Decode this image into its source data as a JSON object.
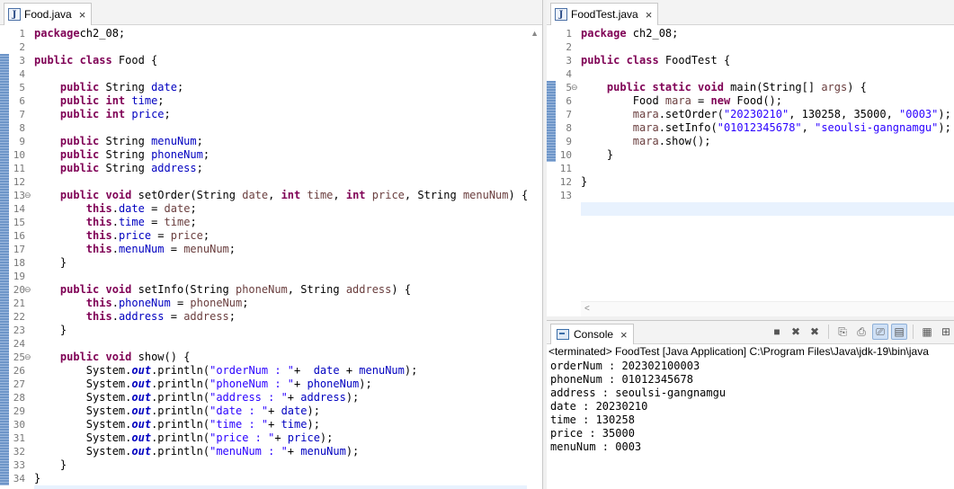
{
  "left_editor": {
    "tab_icon": "java-file-icon",
    "tab_label": "Food.java",
    "close_glyph": "×",
    "fold_glyph": "⊖",
    "current_line": 35,
    "changed_lines": [
      3,
      4,
      5,
      6,
      7,
      8,
      9,
      10,
      11,
      12,
      13,
      14,
      15,
      16,
      17,
      18,
      19,
      20,
      21,
      22,
      23,
      24,
      25,
      26,
      27,
      28,
      29,
      30,
      31,
      32,
      33,
      34
    ],
    "lines": [
      {
        "n": "1",
        "tokens": [
          [
            "kw",
            "package"
          ],
          [
            "",
            "ch2_08;"
          ]
        ]
      },
      {
        "n": "2",
        "tokens": []
      },
      {
        "n": "3",
        "tokens": [
          [
            "kw",
            "public class"
          ],
          [
            "",
            " Food {"
          ]
        ]
      },
      {
        "n": "4",
        "tokens": []
      },
      {
        "n": "5",
        "tokens": [
          [
            "",
            "    "
          ],
          [
            "kw",
            "public"
          ],
          [
            "",
            " String "
          ],
          [
            "fld",
            "date"
          ],
          [
            "",
            ";"
          ]
        ]
      },
      {
        "n": "6",
        "tokens": [
          [
            "",
            "    "
          ],
          [
            "kw",
            "public int"
          ],
          [
            "",
            " "
          ],
          [
            "fld",
            "time"
          ],
          [
            "",
            ";"
          ]
        ]
      },
      {
        "n": "7",
        "tokens": [
          [
            "",
            "    "
          ],
          [
            "kw",
            "public int"
          ],
          [
            "",
            " "
          ],
          [
            "fld",
            "price"
          ],
          [
            "",
            ";"
          ]
        ]
      },
      {
        "n": "8",
        "tokens": []
      },
      {
        "n": "9",
        "tokens": [
          [
            "",
            "    "
          ],
          [
            "kw",
            "public"
          ],
          [
            "",
            " String "
          ],
          [
            "fld",
            "menuNum"
          ],
          [
            "",
            ";"
          ]
        ]
      },
      {
        "n": "10",
        "tokens": [
          [
            "",
            "    "
          ],
          [
            "kw",
            "public"
          ],
          [
            "",
            " String "
          ],
          [
            "fld",
            "phoneNum"
          ],
          [
            "",
            ";"
          ]
        ]
      },
      {
        "n": "11",
        "tokens": [
          [
            "",
            "    "
          ],
          [
            "kw",
            "public"
          ],
          [
            "",
            " String "
          ],
          [
            "fld",
            "address"
          ],
          [
            "",
            ";"
          ]
        ]
      },
      {
        "n": "12",
        "tokens": []
      },
      {
        "n": "13",
        "fold": true,
        "tokens": [
          [
            "",
            "    "
          ],
          [
            "kw",
            "public void"
          ],
          [
            "",
            " setOrder(String "
          ],
          [
            "par",
            "date"
          ],
          [
            "",
            ", "
          ],
          [
            "kw",
            "int"
          ],
          [
            "",
            " "
          ],
          [
            "par",
            "time"
          ],
          [
            "",
            ", "
          ],
          [
            "kw",
            "int"
          ],
          [
            "",
            " "
          ],
          [
            "par",
            "price"
          ],
          [
            "",
            ", String "
          ],
          [
            "par",
            "menuNum"
          ],
          [
            "",
            ") {"
          ]
        ]
      },
      {
        "n": "14",
        "tokens": [
          [
            "",
            "        "
          ],
          [
            "kw",
            "this"
          ],
          [
            "",
            "."
          ],
          [
            "fld",
            "date"
          ],
          [
            "",
            " = "
          ],
          [
            "par",
            "date"
          ],
          [
            "",
            ";"
          ]
        ]
      },
      {
        "n": "15",
        "tokens": [
          [
            "",
            "        "
          ],
          [
            "kw",
            "this"
          ],
          [
            "",
            "."
          ],
          [
            "fld",
            "time"
          ],
          [
            "",
            " = "
          ],
          [
            "par",
            "time"
          ],
          [
            "",
            ";"
          ]
        ]
      },
      {
        "n": "16",
        "tokens": [
          [
            "",
            "        "
          ],
          [
            "kw",
            "this"
          ],
          [
            "",
            "."
          ],
          [
            "fld",
            "price"
          ],
          [
            "",
            " = "
          ],
          [
            "par",
            "price"
          ],
          [
            "",
            ";"
          ]
        ]
      },
      {
        "n": "17",
        "tokens": [
          [
            "",
            "        "
          ],
          [
            "kw",
            "this"
          ],
          [
            "",
            "."
          ],
          [
            "fld",
            "menuNum"
          ],
          [
            "",
            " = "
          ],
          [
            "par",
            "menuNum"
          ],
          [
            "",
            ";"
          ]
        ]
      },
      {
        "n": "18",
        "tokens": [
          [
            "",
            "    }"
          ]
        ]
      },
      {
        "n": "19",
        "tokens": []
      },
      {
        "n": "20",
        "fold": true,
        "tokens": [
          [
            "",
            "    "
          ],
          [
            "kw",
            "public void"
          ],
          [
            "",
            " setInfo(String "
          ],
          [
            "par",
            "phoneNum"
          ],
          [
            "",
            ", String "
          ],
          [
            "par",
            "address"
          ],
          [
            "",
            ") {"
          ]
        ]
      },
      {
        "n": "21",
        "tokens": [
          [
            "",
            "        "
          ],
          [
            "kw",
            "this"
          ],
          [
            "",
            "."
          ],
          [
            "fld",
            "phoneNum"
          ],
          [
            "",
            " = "
          ],
          [
            "par",
            "phoneNum"
          ],
          [
            "",
            ";"
          ]
        ]
      },
      {
        "n": "22",
        "tokens": [
          [
            "",
            "        "
          ],
          [
            "kw",
            "this"
          ],
          [
            "",
            "."
          ],
          [
            "fld",
            "address"
          ],
          [
            "",
            " = "
          ],
          [
            "par",
            "address"
          ],
          [
            "",
            ";"
          ]
        ]
      },
      {
        "n": "23",
        "tokens": [
          [
            "",
            "    }"
          ]
        ]
      },
      {
        "n": "24",
        "tokens": []
      },
      {
        "n": "25",
        "fold": true,
        "tokens": [
          [
            "",
            "    "
          ],
          [
            "kw",
            "public void"
          ],
          [
            "",
            " show() {"
          ]
        ]
      },
      {
        "n": "26",
        "tokens": [
          [
            "",
            "        System."
          ],
          [
            "st",
            "out"
          ],
          [
            "",
            ".println("
          ],
          [
            "str",
            "\"orderNum : \""
          ],
          [
            "",
            "+  "
          ],
          [
            "fld",
            "date"
          ],
          [
            "",
            " + "
          ],
          [
            "fld",
            "menuNum"
          ],
          [
            "",
            ");"
          ]
        ]
      },
      {
        "n": "27",
        "tokens": [
          [
            "",
            "        System."
          ],
          [
            "st",
            "out"
          ],
          [
            "",
            ".println("
          ],
          [
            "str",
            "\"phoneNum : \""
          ],
          [
            "",
            "+ "
          ],
          [
            "fld",
            "phoneNum"
          ],
          [
            "",
            ");"
          ]
        ]
      },
      {
        "n": "28",
        "tokens": [
          [
            "",
            "        System."
          ],
          [
            "st",
            "out"
          ],
          [
            "",
            ".println("
          ],
          [
            "str",
            "\"address : \""
          ],
          [
            "",
            "+ "
          ],
          [
            "fld",
            "address"
          ],
          [
            "",
            ");"
          ]
        ]
      },
      {
        "n": "29",
        "tokens": [
          [
            "",
            "        System."
          ],
          [
            "st",
            "out"
          ],
          [
            "",
            ".println("
          ],
          [
            "str",
            "\"date : \""
          ],
          [
            "",
            "+ "
          ],
          [
            "fld",
            "date"
          ],
          [
            "",
            ");"
          ]
        ]
      },
      {
        "n": "30",
        "tokens": [
          [
            "",
            "        System."
          ],
          [
            "st",
            "out"
          ],
          [
            "",
            ".println("
          ],
          [
            "str",
            "\"time : \""
          ],
          [
            "",
            "+ "
          ],
          [
            "fld",
            "time"
          ],
          [
            "",
            ");"
          ]
        ]
      },
      {
        "n": "31",
        "tokens": [
          [
            "",
            "        System."
          ],
          [
            "st",
            "out"
          ],
          [
            "",
            ".println("
          ],
          [
            "str",
            "\"price : \""
          ],
          [
            "",
            "+ "
          ],
          [
            "fld",
            "price"
          ],
          [
            "",
            ");"
          ]
        ]
      },
      {
        "n": "32",
        "tokens": [
          [
            "",
            "        System."
          ],
          [
            "st",
            "out"
          ],
          [
            "",
            ".println("
          ],
          [
            "str",
            "\"menuNum : \""
          ],
          [
            "",
            "+ "
          ],
          [
            "fld",
            "menuNum"
          ],
          [
            "",
            ");"
          ]
        ]
      },
      {
        "n": "33",
        "tokens": [
          [
            "",
            "    }"
          ]
        ]
      },
      {
        "n": "34",
        "tokens": [
          [
            "",
            "}"
          ]
        ]
      },
      {
        "n": "",
        "tokens": []
      }
    ]
  },
  "right_editor": {
    "tab_icon": "java-file-icon",
    "tab_label": "FoodTest.java",
    "close_glyph": "×",
    "fold_glyph": "⊖",
    "current_line": 14,
    "changed_lines": [
      5,
      6,
      7,
      8,
      9,
      10
    ],
    "lines": [
      {
        "n": "1",
        "tokens": [
          [
            "kw",
            "package"
          ],
          [
            "",
            " ch2_08;"
          ]
        ]
      },
      {
        "n": "2",
        "tokens": []
      },
      {
        "n": "3",
        "tokens": [
          [
            "kw",
            "public class"
          ],
          [
            "",
            " FoodTest {"
          ]
        ]
      },
      {
        "n": "4",
        "tokens": []
      },
      {
        "n": "5",
        "fold": true,
        "tokens": [
          [
            "",
            "    "
          ],
          [
            "kw",
            "public static void"
          ],
          [
            "",
            " main(String[] "
          ],
          [
            "par",
            "args"
          ],
          [
            "",
            ") {"
          ]
        ]
      },
      {
        "n": "6",
        "tokens": [
          [
            "",
            "        Food "
          ],
          [
            "par",
            "mara"
          ],
          [
            "",
            " = "
          ],
          [
            "kw",
            "new"
          ],
          [
            "",
            " Food();"
          ]
        ]
      },
      {
        "n": "7",
        "tokens": [
          [
            "",
            "        "
          ],
          [
            "par",
            "mara"
          ],
          [
            "",
            ".setOrder("
          ],
          [
            "str",
            "\"20230210\""
          ],
          [
            "",
            ", 130258, 35000, "
          ],
          [
            "str",
            "\"0003\""
          ],
          [
            "",
            ");"
          ]
        ]
      },
      {
        "n": "8",
        "tokens": [
          [
            "",
            "        "
          ],
          [
            "par",
            "mara"
          ],
          [
            "",
            ".setInfo("
          ],
          [
            "str",
            "\"01012345678\""
          ],
          [
            "",
            ", "
          ],
          [
            "str",
            "\"seoulsi-gangnamgu\""
          ],
          [
            "",
            ");"
          ]
        ]
      },
      {
        "n": "9",
        "tokens": [
          [
            "",
            "        "
          ],
          [
            "par",
            "mara"
          ],
          [
            "",
            ".show();"
          ]
        ]
      },
      {
        "n": "10",
        "tokens": [
          [
            "",
            "    }"
          ]
        ]
      },
      {
        "n": "11",
        "tokens": []
      },
      {
        "n": "12",
        "tokens": [
          [
            "",
            "}"
          ]
        ]
      },
      {
        "n": "13",
        "tokens": []
      },
      {
        "n": "",
        "tokens": []
      }
    ]
  },
  "console": {
    "tab_label": "Console",
    "close_glyph": "×",
    "status": "<terminated> FoodTest [Java Application] C:\\Program Files\\Java\\jdk-19\\bin\\java",
    "toolbar": [
      "■",
      "✖",
      "✖",
      "⎘",
      "⎙",
      "⎚",
      "▤",
      "▦",
      "⊞"
    ],
    "output": [
      "orderNum : 202302100003",
      "phoneNum : 01012345678",
      "address : seoulsi-gangnamgu",
      "date : 20230210",
      "time : 130258",
      "price : 35000",
      "menuNum : 0003"
    ]
  }
}
